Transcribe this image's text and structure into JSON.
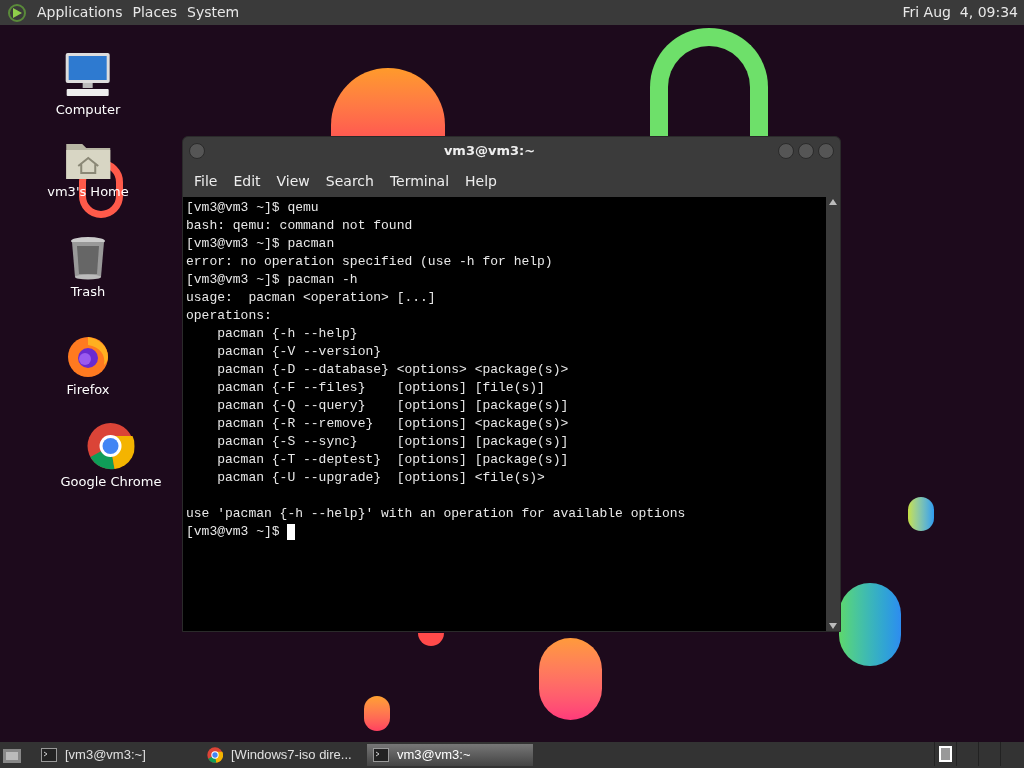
{
  "top_panel": {
    "menus": [
      "Applications",
      "Places",
      "System"
    ],
    "clock": "Fri Aug  4, 09:34"
  },
  "desktop_icons": [
    {
      "kind": "computer",
      "label": "Computer"
    },
    {
      "kind": "home",
      "label": "vm3's Home"
    },
    {
      "kind": "trash",
      "label": "Trash"
    },
    {
      "kind": "firefox",
      "label": "Firefox"
    },
    {
      "kind": "chrome",
      "label": "Google Chrome"
    }
  ],
  "terminal": {
    "title": "vm3@vm3:~",
    "menu": [
      "File",
      "Edit",
      "View",
      "Search",
      "Terminal",
      "Help"
    ],
    "lines": [
      "[vm3@vm3 ~]$ qemu",
      "bash: qemu: command not found",
      "[vm3@vm3 ~]$ pacman",
      "error: no operation specified (use -h for help)",
      "[vm3@vm3 ~]$ pacman -h",
      "usage:  pacman <operation> [...]",
      "operations:",
      "    pacman {-h --help}",
      "    pacman {-V --version}",
      "    pacman {-D --database} <options> <package(s)>",
      "    pacman {-F --files}    [options] [file(s)]",
      "    pacman {-Q --query}    [options] [package(s)]",
      "    pacman {-R --remove}   [options] <package(s)>",
      "    pacman {-S --sync}     [options] [package(s)]",
      "    pacman {-T --deptest}  [options] [package(s)]",
      "    pacman {-U --upgrade}  [options] <file(s)>"
    ],
    "hint": "use 'pacman {-h --help}' with an operation for available options",
    "prompt": "[vm3@vm3 ~]$ "
  },
  "taskbar": {
    "items": [
      {
        "kind": "terminal",
        "label": "[vm3@vm3:~]",
        "selected": false
      },
      {
        "kind": "chrome",
        "label": "[Windows7-iso dire...",
        "selected": false
      },
      {
        "kind": "terminal",
        "label": "vm3@vm3:~",
        "selected": true
      }
    ],
    "workspaces": [
      {
        "selected": true
      },
      {
        "selected": false
      },
      {
        "selected": false
      },
      {
        "selected": false
      }
    ]
  }
}
